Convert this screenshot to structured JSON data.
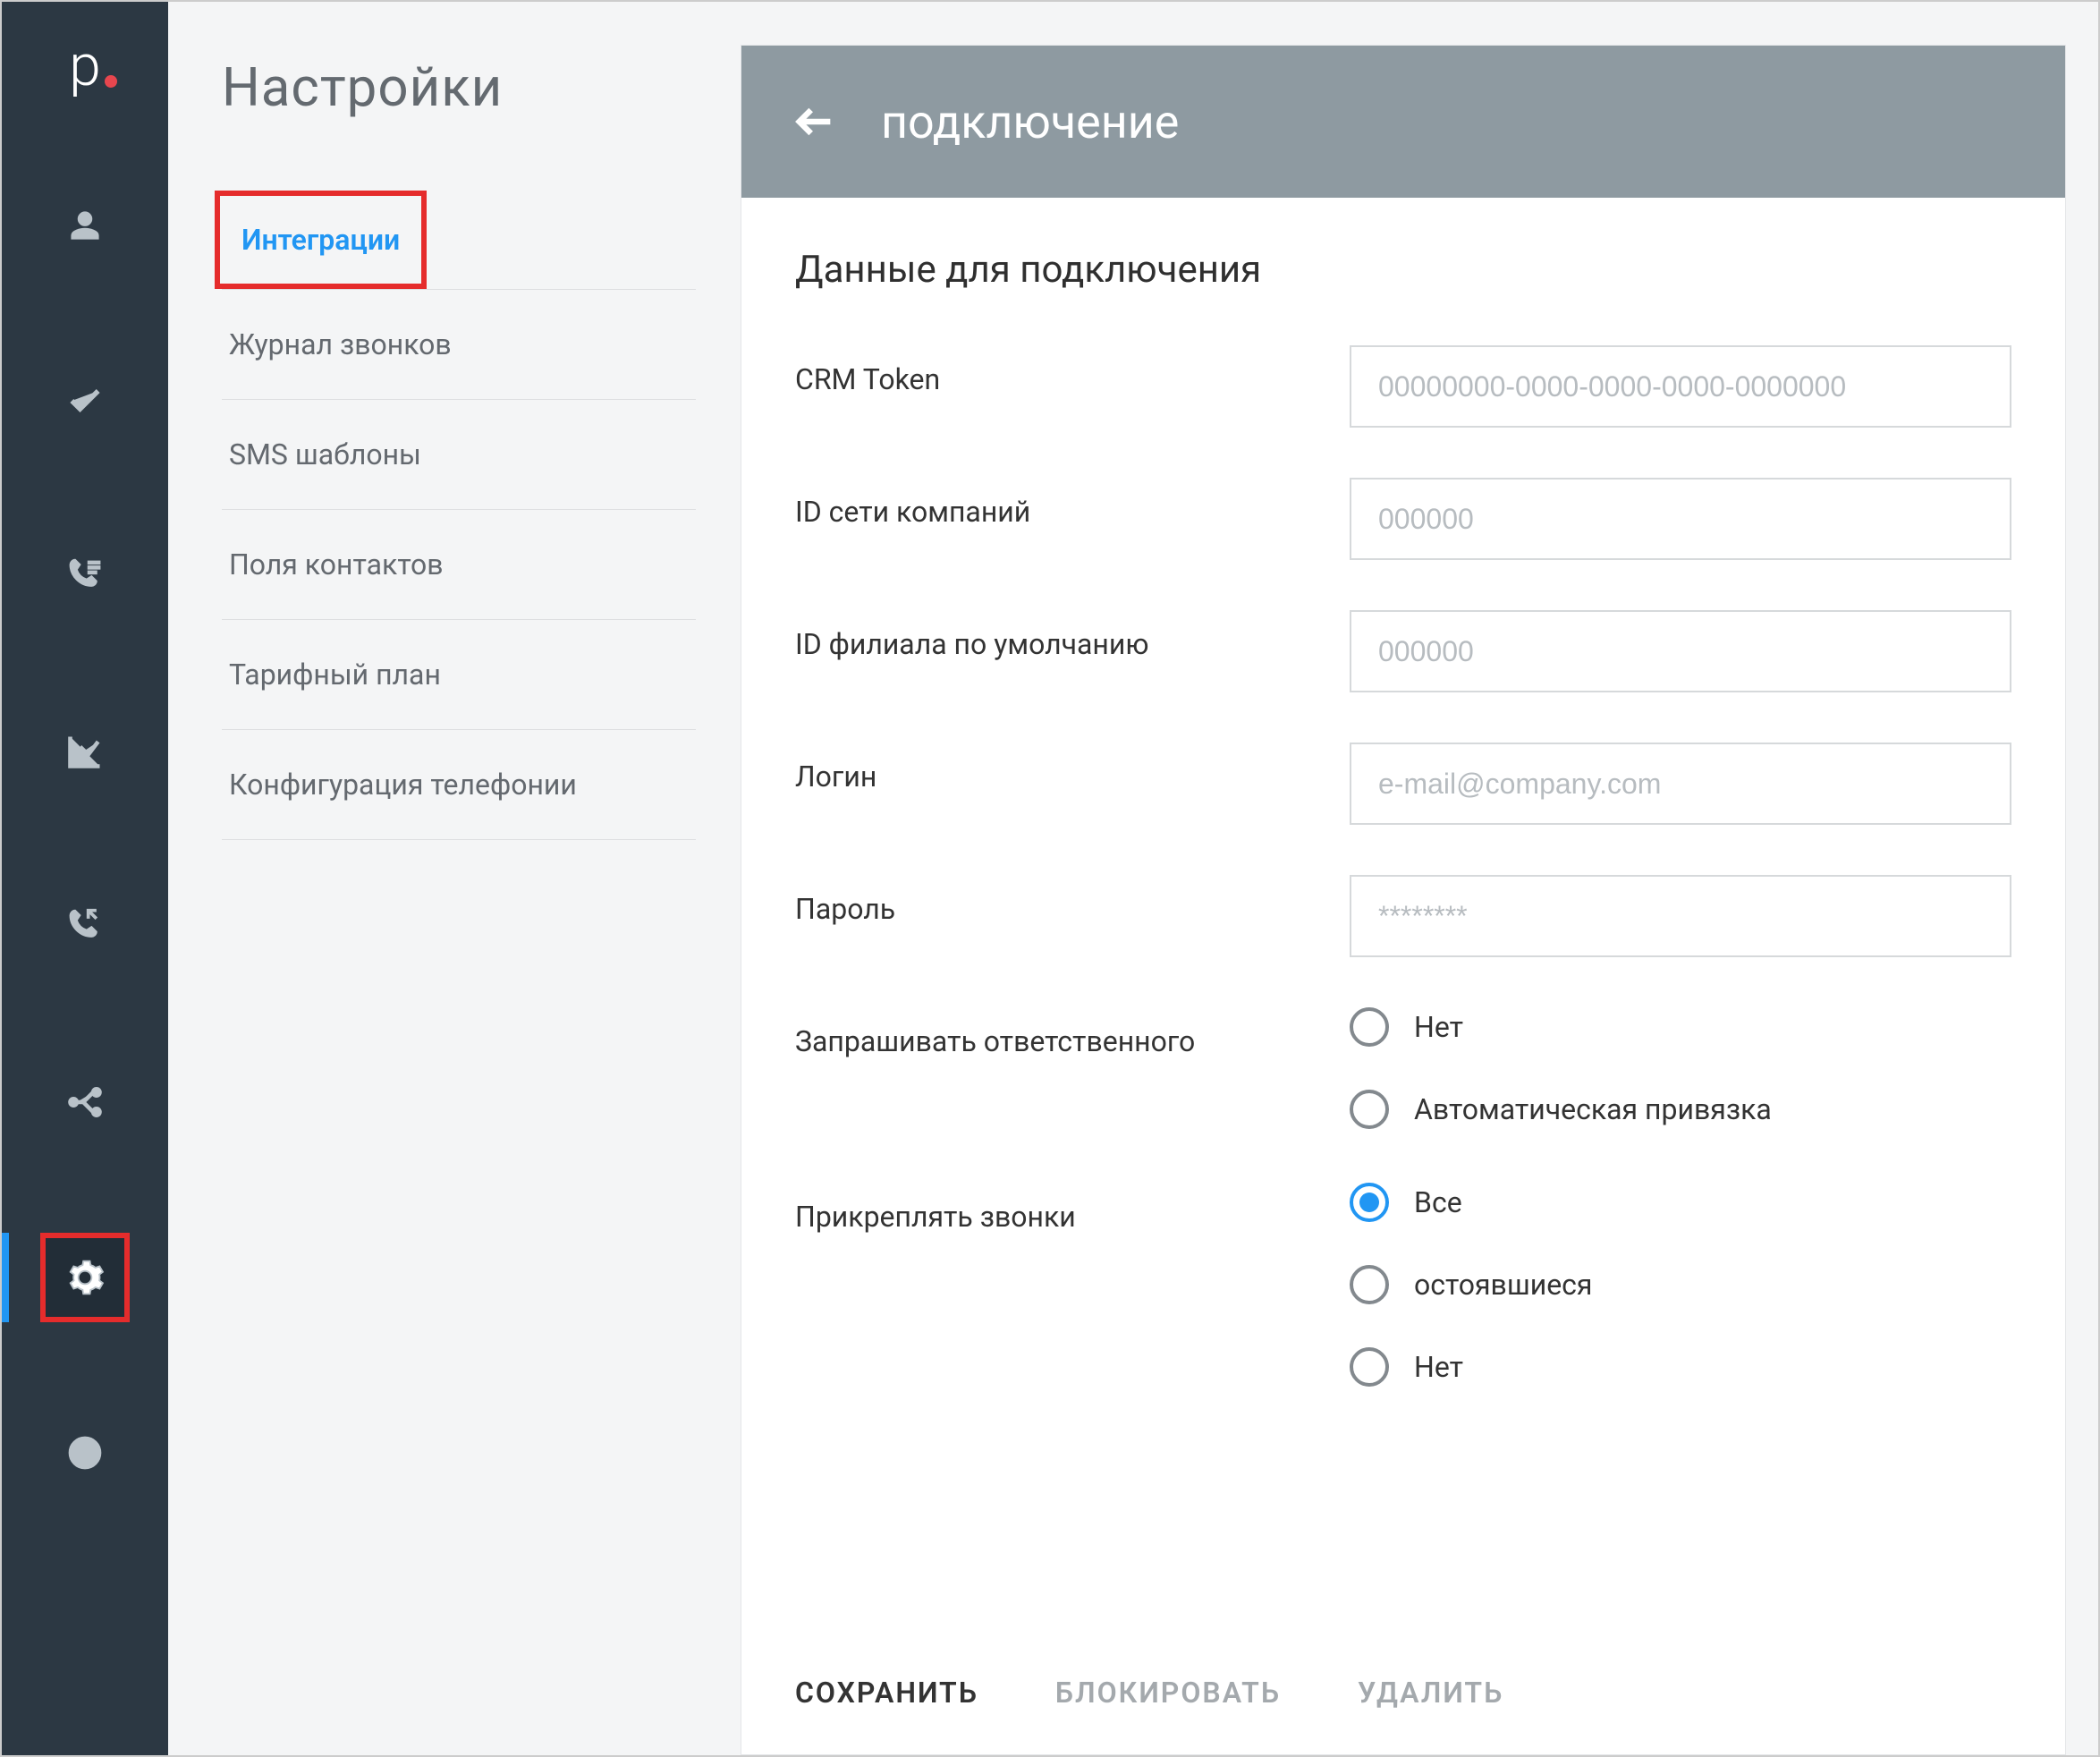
{
  "rail": {
    "logo_letter": "p",
    "items": [
      {
        "name": "profile",
        "active": false
      },
      {
        "name": "tasks",
        "active": false
      },
      {
        "name": "calls",
        "active": false
      },
      {
        "name": "analytics",
        "active": false
      },
      {
        "name": "callback",
        "active": false
      },
      {
        "name": "routing",
        "active": false
      },
      {
        "name": "settings",
        "active": true
      },
      {
        "name": "help",
        "active": false
      }
    ]
  },
  "subnav": {
    "title": "Настройки",
    "items": [
      {
        "label": "Интеграции",
        "active": true
      },
      {
        "label": "Журнал звонков",
        "active": false
      },
      {
        "label": "SMS шаблоны",
        "active": false
      },
      {
        "label": "Поля контактов",
        "active": false
      },
      {
        "label": "Тарифный план",
        "active": false
      },
      {
        "label": "Конфигурация телефонии",
        "active": false
      }
    ]
  },
  "panel": {
    "header_title": "подключение",
    "section_title": "Данные для подключения",
    "fields": {
      "crm_token": {
        "label": "CRM Token",
        "placeholder": "00000000-0000-0000-0000-0000000",
        "value": ""
      },
      "network_id": {
        "label": "ID сети компаний",
        "placeholder": "000000",
        "value": ""
      },
      "branch_id": {
        "label": "ID филиала по умолчанию",
        "placeholder": "000000",
        "value": ""
      },
      "login": {
        "label": "Логин",
        "placeholder": "e-mail@company.com",
        "value": ""
      },
      "password": {
        "label": "Пароль",
        "placeholder": "********",
        "value": ""
      }
    },
    "radio_responsible": {
      "label": "Запрашивать ответственного",
      "options": [
        {
          "label": "Нет",
          "checked": false
        },
        {
          "label": "Автоматическая привязка",
          "checked": false
        }
      ]
    },
    "radio_attach": {
      "label": "Прикреплять звонки",
      "options": [
        {
          "label": "Все",
          "checked": true
        },
        {
          "label": "остоявшиеся",
          "checked": false
        },
        {
          "label": "Нет",
          "checked": false
        }
      ]
    },
    "footer": {
      "save": "СОХРАНИТЬ",
      "block": "БЛОКИРОВАТЬ",
      "delete": "УДАЛИТЬ"
    }
  }
}
